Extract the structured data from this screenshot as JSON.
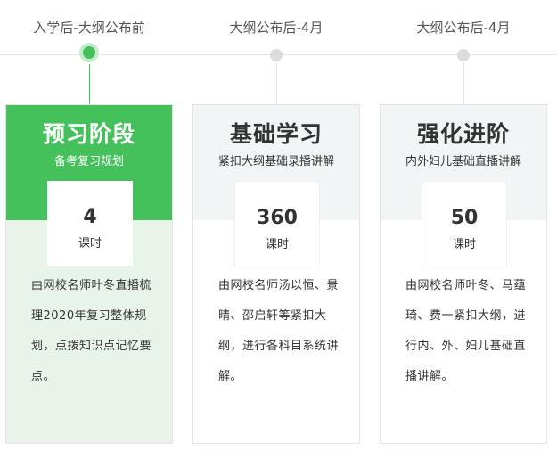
{
  "phases": [
    {
      "timeline_label": "入学后-大纲公布前",
      "title": "预习阶段",
      "subtitle": "备考复习规划",
      "hours": "4",
      "hours_unit": "课时",
      "description": "由网校名师叶冬直播梳理2020年复习整体规划，点拨知识点记忆要点。",
      "active": true
    },
    {
      "timeline_label": "大纲公布后-4月",
      "title": "基础学习",
      "subtitle": "紧扣大纲基础录播讲解",
      "hours": "360",
      "hours_unit": "课时",
      "description": "由网校名师汤以恒、景晴、邵启轩等紧扣大纲，进行各科目系统讲解。",
      "active": false
    },
    {
      "timeline_label": "大纲公布后-4月",
      "title": "强化进阶",
      "subtitle": "内外妇儿基础直播讲解",
      "hours": "50",
      "hours_unit": "课时",
      "description": "由网校名师叶冬、马蕴琦、费一紧扣大纲，进行内、外、妇儿基础直播讲解。",
      "active": false
    }
  ],
  "colors": {
    "accent": "#44c15a",
    "active_card_bg": "#e8f3e9",
    "inactive_head_bg": "#f2f5f5",
    "border": "#e3e3e3"
  }
}
